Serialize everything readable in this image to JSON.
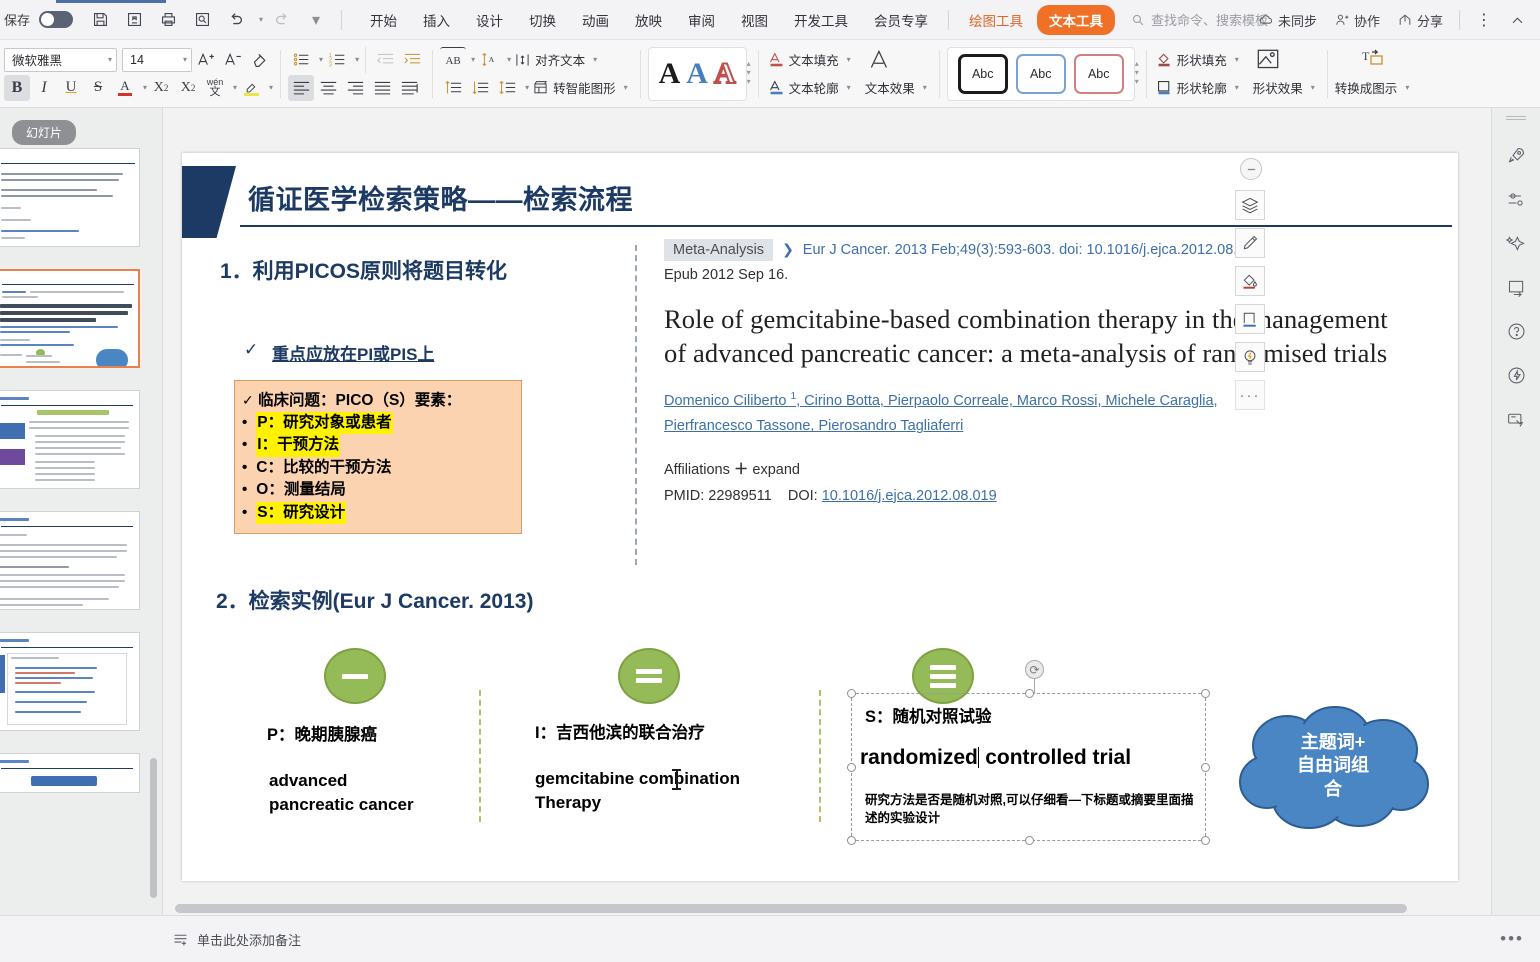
{
  "titlebar": {
    "save_label": "保存",
    "quick_icons": [
      "save-icon",
      "save-as-icon",
      "print-icon",
      "print-preview-icon",
      "undo-icon",
      "redo-icon",
      "customize-icon"
    ],
    "menus": [
      "开始",
      "插入",
      "设计",
      "切换",
      "动画",
      "放映",
      "审阅",
      "视图",
      "开发工具",
      "会员专享"
    ],
    "tool_tabs": [
      {
        "label": "绘图工具",
        "style": "draw"
      },
      {
        "label": "文本工具",
        "style": "text"
      }
    ],
    "search_placeholder": "查找命令、搜索模板",
    "right_items": [
      {
        "label": "未同步",
        "icon": "cloud-sync-icon"
      },
      {
        "label": "协作",
        "icon": "collaborate-icon"
      },
      {
        "label": "分享",
        "icon": "share-icon"
      }
    ],
    "more_icon": "more-vertical-icon",
    "collapse_icon": "chevron-up-icon"
  },
  "ribbon": {
    "font_name": "微软雅黑",
    "font_size": "14",
    "font_icons": [
      "grow-font-icon",
      "shrink-font-icon",
      "clear-format-icon"
    ],
    "style_icons": [
      "bold-icon",
      "italic-icon",
      "underline-icon",
      "strikethrough-icon",
      "font-color-icon",
      "superscript-icon",
      "subscript-icon",
      "char-shading-icon",
      "highlight-icon"
    ],
    "bold_label": "B",
    "italic_label": "I",
    "underline_label": "U",
    "strike_label": "S",
    "fontcolor_label": "A",
    "sup_label": "X",
    "sup_exp": "2",
    "sub_label": "X",
    "sub_exp": "2",
    "pinyin_label": "wén",
    "para_icons": [
      "bullets-icon",
      "numbering-icon",
      "decrease-indent-icon",
      "increase-indent-icon",
      "align-left-icon",
      "align-center-icon",
      "align-right-icon",
      "justify-icon",
      "distribute-icon"
    ],
    "ab_label": "AB",
    "text_direction_icon": "text-direction-icon",
    "align_text_label": "对齐文本",
    "smartart_label": "转智能图形",
    "line_spacing_icons": [
      "space-before-icon",
      "space-after-icon",
      "line-spacing-icon"
    ],
    "wordart_gallery": [
      {
        "label": "A",
        "color": "#1b1b1b"
      },
      {
        "label": "A",
        "color": "#4a7ebb"
      },
      {
        "label": "A",
        "color": "#c0504d"
      }
    ],
    "text_fill_label": "文本填充",
    "text_outline_label": "文本轮廓",
    "text_effect_label": "文本效果",
    "shape_gallery": [
      {
        "label": "Abc",
        "border": "#1b1b1b"
      },
      {
        "label": "Abc",
        "border": "#7ba2d0"
      },
      {
        "label": "Abc",
        "border": "#d08080"
      }
    ],
    "shape_fill_label": "形状填充",
    "shape_outline_label": "形状轮廓",
    "shape_effect_label": "形状效果",
    "convert_to_icon_label": "转换成图示"
  },
  "left_panel": {
    "tab_label": "幻灯片",
    "thumbnails": [
      {
        "index": 1,
        "selected": false
      },
      {
        "index": 2,
        "selected": true
      },
      {
        "index": 3,
        "selected": false
      },
      {
        "index": 4,
        "selected": false
      },
      {
        "index": 5,
        "selected": false
      },
      {
        "index": 6,
        "selected": false
      }
    ]
  },
  "slide": {
    "title": "循证医学检索策略——检索流程",
    "heading1": "1．利用PICOS原则将题目转化",
    "subpoint1": "重点应放在PI或PIS上",
    "pico_box": {
      "head": "临床问题：PICO（S）要素：",
      "items": [
        {
          "text": "P：研究对象或患者",
          "highlight": true
        },
        {
          "text": "I：干预方法",
          "highlight": true
        },
        {
          "text": "C：比较的干预方法",
          "highlight": false
        },
        {
          "text": "O：测量结局",
          "highlight": false
        },
        {
          "text": "S：研究设计",
          "highlight": true
        }
      ]
    },
    "heading2": "2．检索实例(Eur J Cancer. 2013)",
    "pubmed": {
      "tag": "Meta-Analysis",
      "citation": "Eur J Cancer. 2013 Feb;49(3):593-603. doi: 10.1016/j.ejca.2012.08.019.",
      "citation_line2": "Epub 2012 Sep 16.",
      "title": "Role of gemcitabine-based combination therapy in the management of advanced pancreatic cancer: a meta-analysis of randomised trials",
      "authors_line1": "Domenico Ciliberto , Cirino Botta, Pierpaolo Correale, Marco Rossi, Michele Caraglia,",
      "authors_sup": "1",
      "authors_line2": "Pierfrancesco Tassone, Pierosandro Tagliaferri",
      "affiliations_label": "Affiliations",
      "expand_label": "expand",
      "pmid_label": "PMID: 22989511",
      "doi_label": "DOI:",
      "doi_value": "10.1016/j.ejca.2012.08.019"
    },
    "columns": [
      {
        "head": "P：晚期胰腺癌",
        "body": "advanced\npancreatic cancer",
        "badge": "one-bar"
      },
      {
        "head": "I：吉西他滨的联合治疗",
        "body": " gemcitabine combination\nTherapy",
        "badge": "two-bar"
      }
    ],
    "selected_textbox": {
      "line1": "S：随机对照试验",
      "line2": "randomized controlled trial",
      "line3": "研究方法是否是随机对照,可以仔细看—下标题或摘要里面描述的实验设计",
      "badge": "three-bar"
    },
    "cloud_text_lines": [
      "主题词+",
      "自由词组",
      "合"
    ],
    "cloud_color": "#4a85c4"
  },
  "float_toolbar": {
    "items": [
      {
        "name": "minus-button",
        "icon": "minus-icon"
      },
      {
        "name": "layers-button",
        "icon": "layers-icon"
      },
      {
        "name": "format-brush-button",
        "icon": "brush-icon"
      },
      {
        "name": "fill-color-button",
        "icon": "fill-bucket-icon"
      },
      {
        "name": "shape-outline-button",
        "icon": "shape-outline-icon"
      },
      {
        "name": "smart-suggest-button",
        "icon": "lightbulb-icon"
      },
      {
        "name": "more-button",
        "icon": "ellipsis-icon"
      }
    ]
  },
  "right_rail": {
    "items": [
      {
        "name": "rail-item-rocket",
        "icon": "rocket-icon"
      },
      {
        "name": "rail-item-settings",
        "icon": "sliders-icon"
      },
      {
        "name": "rail-item-effects",
        "icon": "sparkle-star-icon"
      },
      {
        "name": "rail-item-replace",
        "icon": "swap-rect-icon"
      },
      {
        "name": "rail-item-help",
        "icon": "question-circle-icon"
      },
      {
        "name": "rail-item-idea",
        "icon": "lightning-circle-icon"
      },
      {
        "name": "rail-item-screenshot",
        "icon": "screenshot-icon"
      }
    ]
  },
  "notes_bar": {
    "placeholder": "单击此处添加备注",
    "icon": "notes-icon",
    "more_icon": "more-horizontal-icon"
  }
}
